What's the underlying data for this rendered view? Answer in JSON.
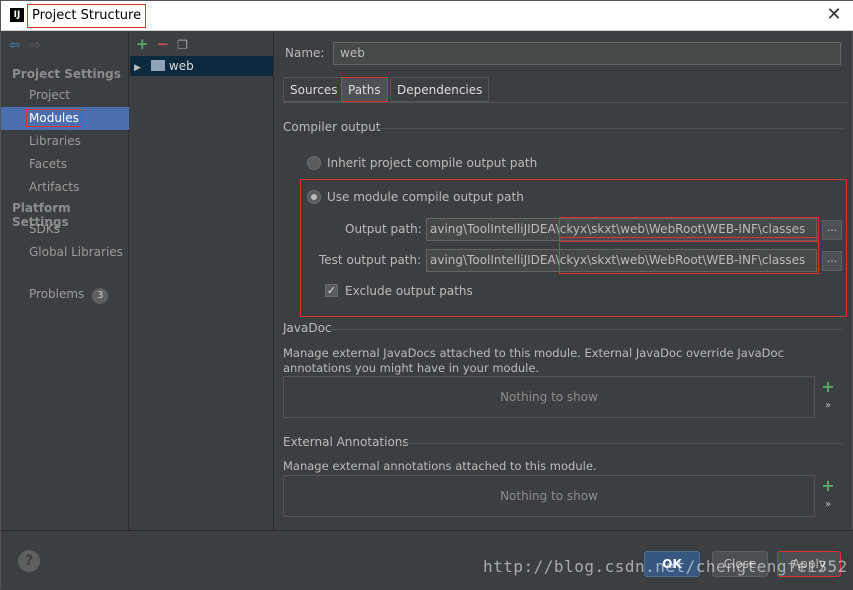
{
  "window": {
    "title": "Project Structure",
    "app_icon": "IJ",
    "close_icon": "close-icon"
  },
  "sidebar": {
    "sections": [
      {
        "label": "Project Settings",
        "items": [
          {
            "label": "Project"
          },
          {
            "label": "Modules",
            "selected": true
          },
          {
            "label": "Libraries"
          },
          {
            "label": "Facets"
          },
          {
            "label": "Artifacts"
          }
        ]
      },
      {
        "label": "Platform Settings",
        "items": [
          {
            "label": "SDKs"
          },
          {
            "label": "Global Libraries"
          }
        ]
      }
    ],
    "problems": {
      "label": "Problems",
      "count": "3"
    }
  },
  "tree": {
    "items": [
      {
        "label": "web"
      }
    ]
  },
  "module": {
    "name_label": "Name:",
    "name_value": "web",
    "tabs": [
      {
        "label": "Sources"
      },
      {
        "label": "Paths",
        "selected": true
      },
      {
        "label": "Dependencies"
      }
    ]
  },
  "compiler_output": {
    "title": "Compiler output",
    "inherit_label": "Inherit project compile output path",
    "use_module_label": "Use module compile output path",
    "selected_option": "use_module",
    "output_path_label": "Output path:",
    "output_path_value": "aving\\ToolIntelliJIDEA\\ckyx\\skxt\\web\\WebRoot\\WEB-INF\\classes",
    "test_output_path_label": "Test output path:",
    "test_output_path_value": "aving\\ToolIntelliJIDEA\\ckyx\\skxt\\web\\WebRoot\\WEB-INF\\classes",
    "browse_label": "...",
    "exclude_label": "Exclude output paths",
    "exclude_checked": true
  },
  "javadoc": {
    "title": "JavaDoc",
    "description": "Manage external JavaDocs attached to this module. External JavaDoc override JavaDoc annotations you might have in your module.",
    "empty_text": "Nothing to show",
    "add_label": "+",
    "more_label": "»"
  },
  "external_annotations": {
    "title": "External Annotations",
    "description": "Manage external annotations attached to this module.",
    "empty_text": "Nothing to show",
    "add_label": "+",
    "more_label": "»"
  },
  "footer": {
    "help_label": "?",
    "ok_label": "OK",
    "close_label": "Close",
    "apply_label": "Apply",
    "watermark": "http://blog.csdn.net/chengtengfei352"
  }
}
